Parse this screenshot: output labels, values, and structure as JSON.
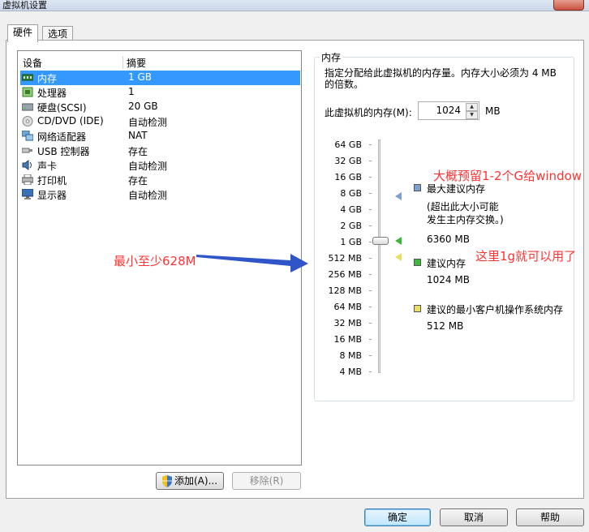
{
  "window": {
    "title": "虚拟机设置"
  },
  "tabs": [
    {
      "label": "硬件"
    },
    {
      "label": "选项"
    }
  ],
  "device_list": {
    "col_device": "设备",
    "col_summary": "摘要",
    "rows": [
      {
        "name": "内存",
        "summary": "1 GB",
        "icon": "memory-icon",
        "selected": true
      },
      {
        "name": "处理器",
        "summary": "1",
        "icon": "processor-icon"
      },
      {
        "name": "硬盘(SCSI)",
        "summary": "20 GB",
        "icon": "hard-disk-icon"
      },
      {
        "name": "CD/DVD (IDE)",
        "summary": "自动检测",
        "icon": "cd-dvd-icon"
      },
      {
        "name": "网络适配器",
        "summary": "NAT",
        "icon": "network-adapter-icon"
      },
      {
        "name": "USB 控制器",
        "summary": "存在",
        "icon": "usb-icon"
      },
      {
        "name": "声卡",
        "summary": "自动检测",
        "icon": "sound-card-icon"
      },
      {
        "name": "打印机",
        "summary": "存在",
        "icon": "printer-icon"
      },
      {
        "name": "显示器",
        "summary": "自动检测",
        "icon": "display-icon"
      }
    ]
  },
  "buttons": {
    "add": "添加(A)...",
    "remove": "移除(R)",
    "ok": "确定",
    "cancel": "取消",
    "help": "帮助"
  },
  "memory": {
    "group_title": "内存",
    "description": "指定分配给此虚拟机的内存量。内存大小必须为 4 MB 的倍数。",
    "field_label": "此虚拟机的内存(M):",
    "value": "1024",
    "unit": "MB",
    "scale_labels": [
      "64 GB",
      "32 GB",
      "16 GB",
      "8 GB",
      "4 GB",
      "2 GB",
      "1 GB",
      "512 MB",
      "256 MB",
      "128 MB",
      "64 MB",
      "32 MB",
      "16 MB",
      "8 MB",
      "4 MB"
    ],
    "current_level": "1 GB",
    "legend": {
      "max_title": "最大建议内存",
      "max_note_1": "(超出此大小可能",
      "max_note_2": "发生主内存交换。)",
      "max_value": "6360 MB",
      "recommended_title": "建议内存",
      "recommended_value": "1024 MB",
      "min_title": "建议的最小客户机操作系统内存",
      "min_value": "512 MB"
    },
    "colors": {
      "max": "#7f9fd0",
      "recommended": "#3cb93c",
      "min": "#e8e060"
    }
  },
  "annotations": {
    "top_right": "大概预留1-2个G给window",
    "middle_right": "这里1g就可以用了",
    "left": "最小至少628M",
    "color": "#ff3333",
    "arrow_color": "#2f55c8"
  }
}
